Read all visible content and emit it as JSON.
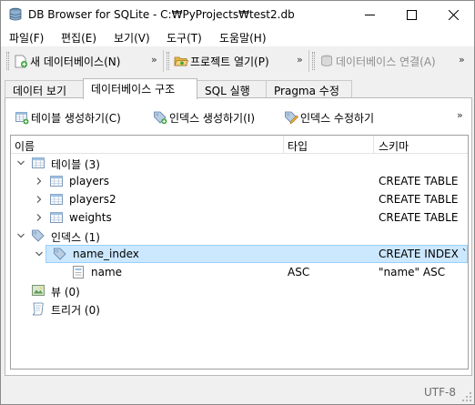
{
  "window": {
    "title": "DB Browser for SQLite - C:₩PyProjects₩test2.db"
  },
  "menu": [
    "파일(F)",
    "편집(E)",
    "보기(V)",
    "도구(T)",
    "도움말(H)"
  ],
  "toolbar": {
    "new_db": "새 데이터베이스(N)",
    "open_project": "프로젝트 열기(P)",
    "attach_db": "데이터베이스 연결(A)",
    "more": "»"
  },
  "tabs": [
    "데이터 보기",
    "데이터베이스 구조",
    "SQL 실행",
    "Pragma 수정"
  ],
  "active_tab": "데이터베이스 구조",
  "structure_toolbar": {
    "create_table": "테이블 생성하기(C)",
    "create_index": "인덱스 생성하기(I)",
    "modify_index": "인덱스 수정하기",
    "more": "»"
  },
  "tree": {
    "columns": [
      "이름",
      "타입",
      "스키마"
    ],
    "rows": [
      {
        "name": "테이블 (3)",
        "type": "",
        "schema": ""
      },
      {
        "name": "players",
        "type": "",
        "schema": "CREATE TABLE"
      },
      {
        "name": "players2",
        "type": "",
        "schema": "CREATE TABLE"
      },
      {
        "name": "weights",
        "type": "",
        "schema": "CREATE TABLE"
      },
      {
        "name": "인덱스 (1)",
        "type": "",
        "schema": ""
      },
      {
        "name": "name_index",
        "type": "",
        "schema": "CREATE INDEX `"
      },
      {
        "name": "name",
        "type": "ASC",
        "schema": "\"name\" ASC"
      },
      {
        "name": "뷰 (0)",
        "type": "",
        "schema": ""
      },
      {
        "name": "트리거 (0)",
        "type": "",
        "schema": ""
      }
    ]
  },
  "status": {
    "encoding": "UTF-8"
  }
}
